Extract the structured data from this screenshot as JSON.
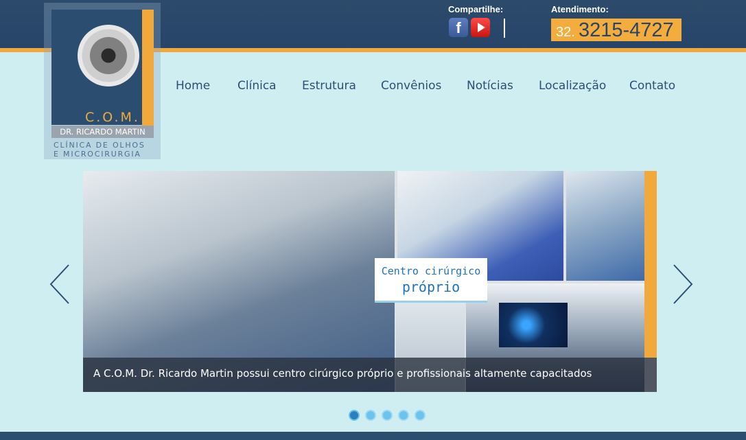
{
  "header": {
    "share_label": "Compartilhe:",
    "attendance_label": "Atendimento:",
    "phone_prefix": "32.",
    "phone_number": "3215-4727",
    "facebook_glyph": "f"
  },
  "logo": {
    "brand": "C.O.M.",
    "name": "DR. RICARDO MARTIN",
    "tagline_1": "CLÍNICA DE OLHOS",
    "tagline_2": "E MICROCIRURGIA"
  },
  "nav": {
    "items": [
      "Home",
      "Clínica",
      "Estrutura",
      "Convênios",
      "Notícias",
      "Localização",
      "Contato"
    ]
  },
  "slider": {
    "tag_line1": "Centro cirúrgico",
    "tag_line2": "próprio",
    "caption": "A C.O.M. Dr. Ricardo Martin possui centro cirúrgico próprio e profissionais altamente capacitados",
    "dots_count": 5,
    "active_dot": 0
  },
  "colors": {
    "top_bar": "#27456a",
    "accent": "#f2a93b",
    "background": "#cfeef2",
    "nav_text": "#2b4f74"
  }
}
